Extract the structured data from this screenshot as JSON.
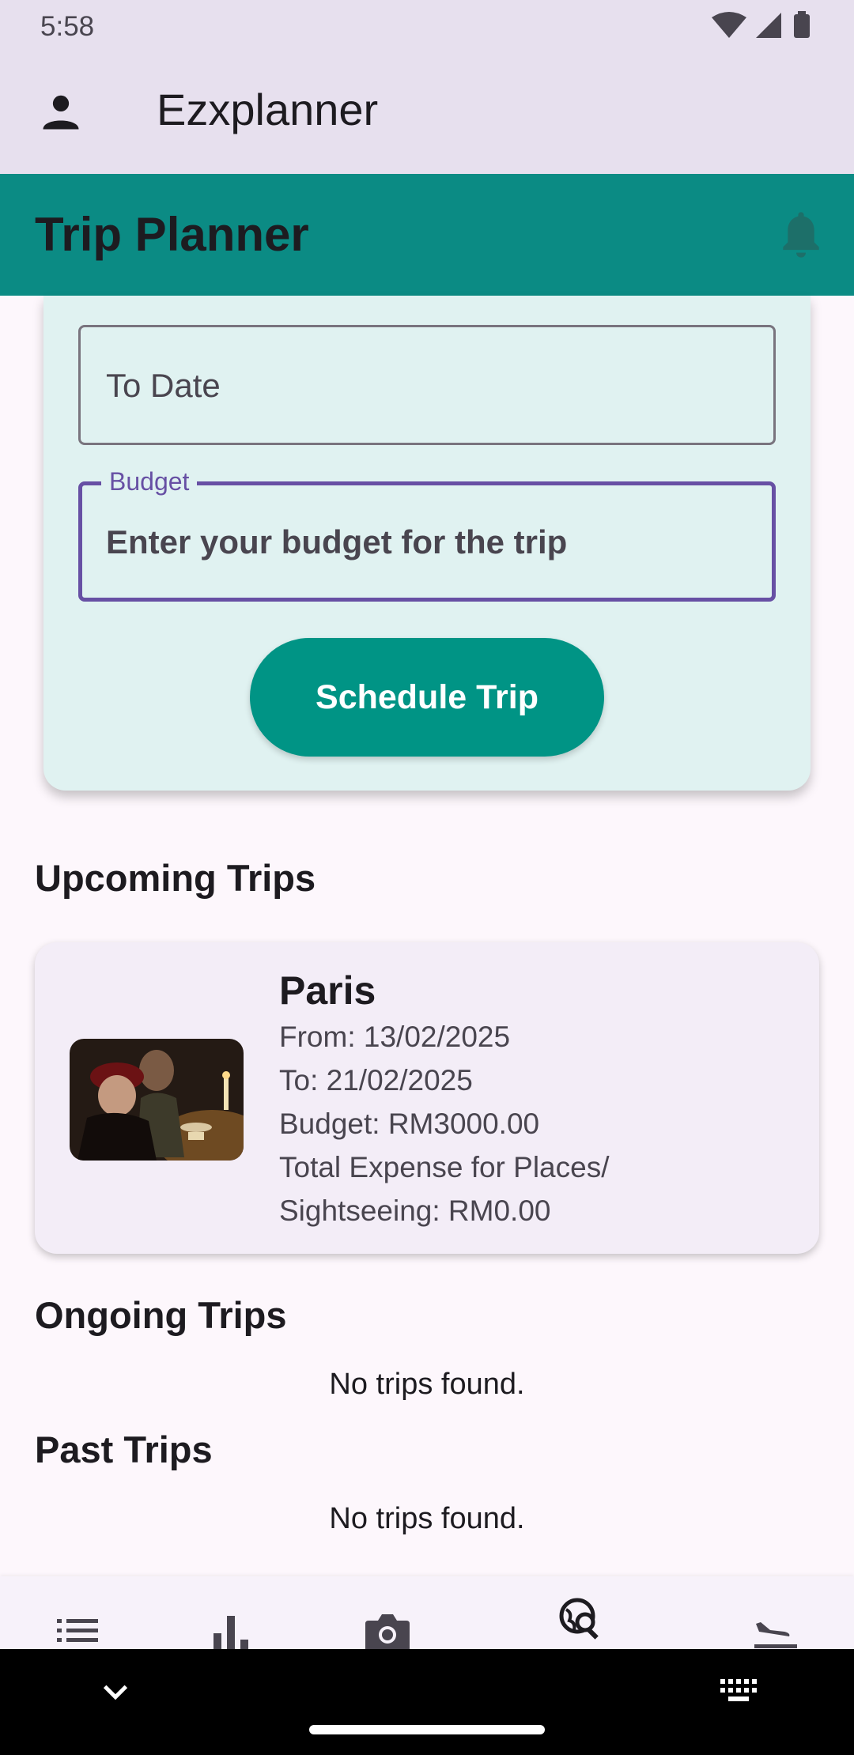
{
  "status_bar": {
    "time": "5:58"
  },
  "app_bar": {
    "title": "Ezxplanner",
    "icon": "person-icon"
  },
  "header": {
    "title": "Trip Planner",
    "icon": "bell-icon"
  },
  "form": {
    "to_date_placeholder": "To Date",
    "budget_label": "Budget",
    "budget_placeholder": "Enter your budget for the trip",
    "schedule_button": "Schedule Trip"
  },
  "sections": {
    "upcoming": "Upcoming Trips",
    "ongoing": "Ongoing Trips",
    "past": "Past Trips",
    "ongoing_empty": "No trips found.",
    "past_empty": "No trips found."
  },
  "upcoming_trips": [
    {
      "name": "Paris",
      "from": "From: 13/02/2025",
      "to": "To: 21/02/2025",
      "budget": "Budget: RM3000.00",
      "expense_line1": "Total Expense for Places/",
      "expense_line2": "Sightseeing: RM0.00"
    }
  ],
  "bottom_nav": {
    "items": [
      "list-icon",
      "bar-chart-icon",
      "camera-icon",
      "travel-explore-icon",
      "flight-land-icon"
    ]
  },
  "colors": {
    "header_teal": "#0b8b84",
    "button_teal": "#009485",
    "card_mint": "#e0f2f1",
    "focus_purple": "#6750a4",
    "app_bar_lavender": "#e7e0ee"
  }
}
